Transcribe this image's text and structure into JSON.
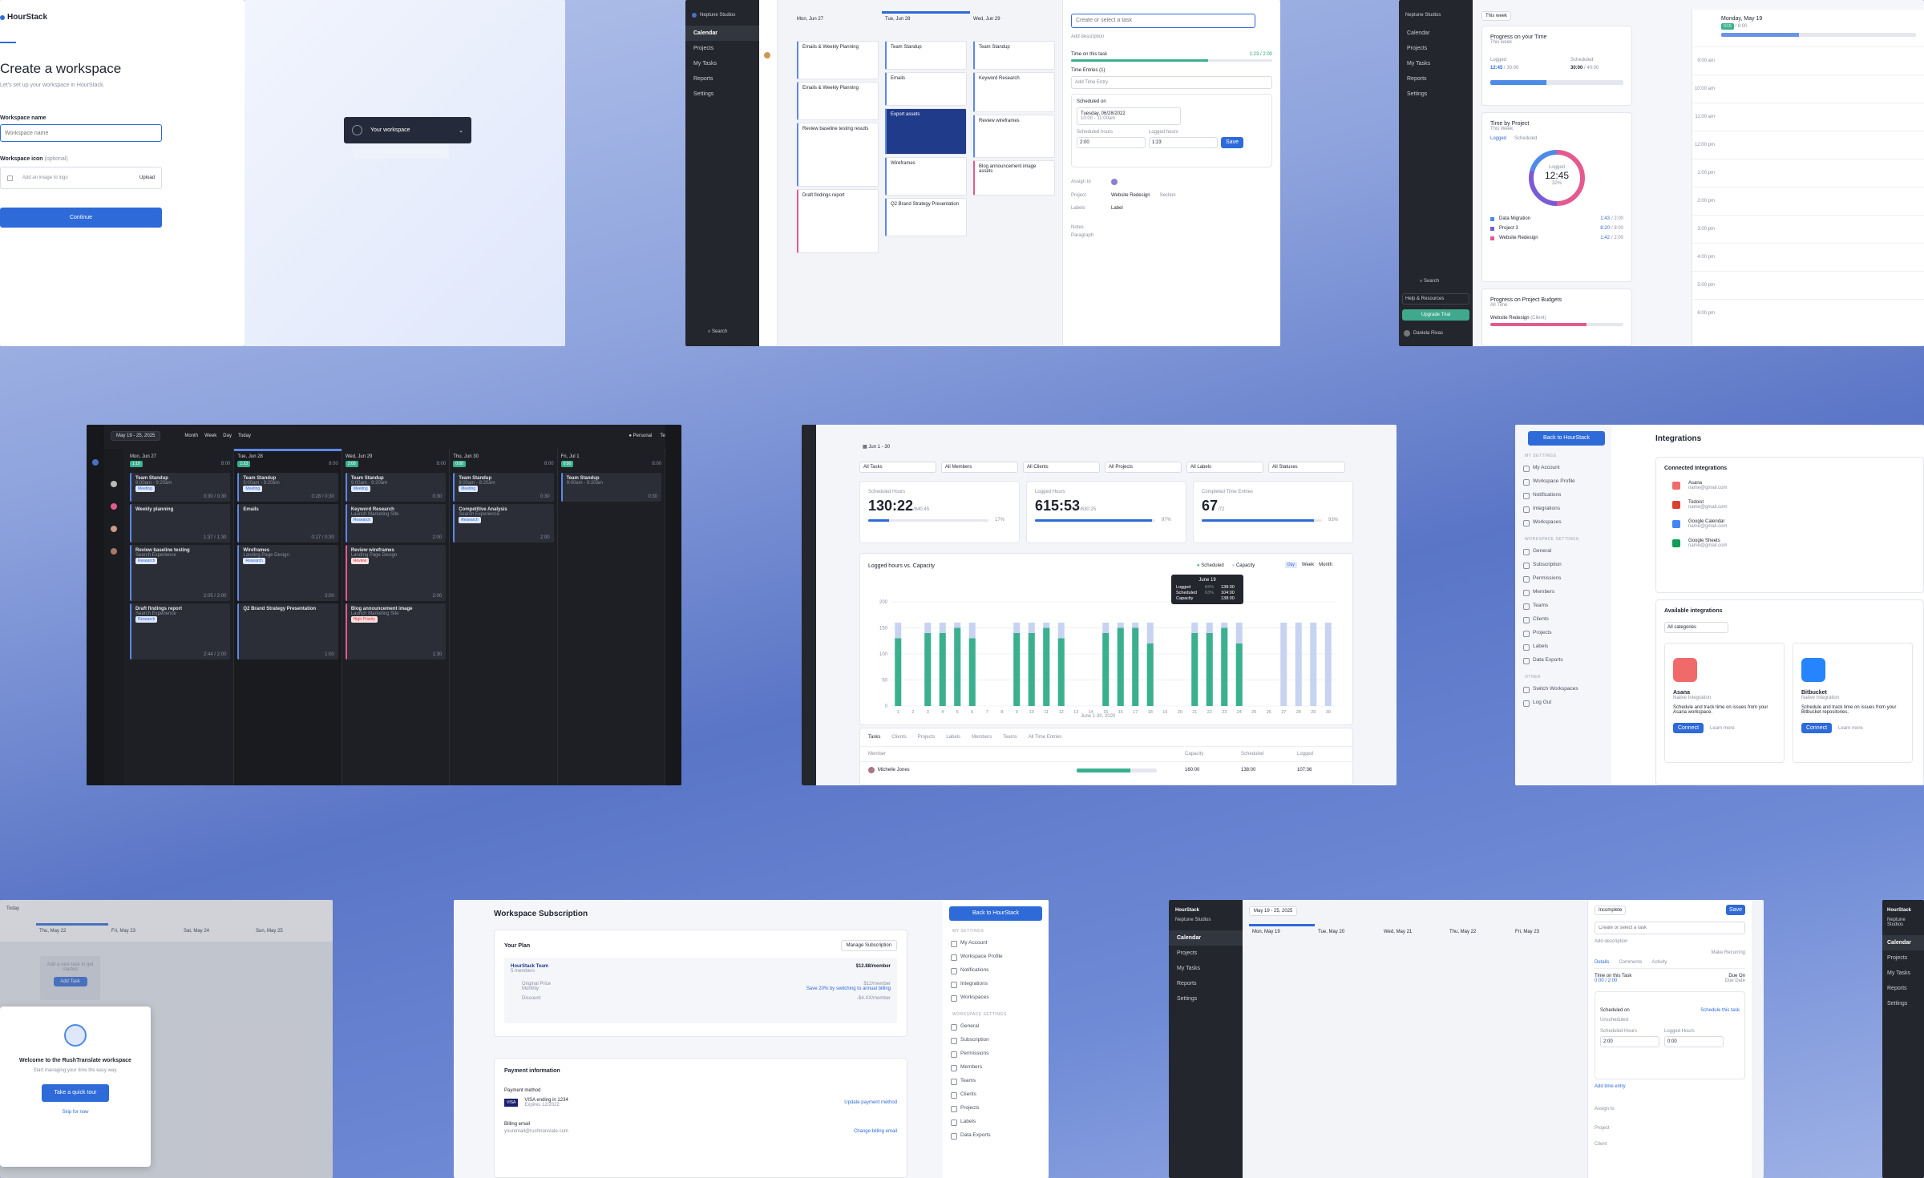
{
  "brand": {
    "name": "HourStack",
    "workspace": "Neptune Studios"
  },
  "onboarding": {
    "title": "Create a workspace",
    "subtitle": "Let's set up your workspace in HourStack.",
    "name_label": "Workspace name",
    "name_placeholder": "Workspace name",
    "icon_label": "Workspace icon",
    "icon_optional": "(optional)",
    "icon_placeholder": "Add an image to logo",
    "upload": "Upload",
    "continue": "Continue",
    "preview_name": "Your workspace"
  },
  "nav": {
    "calendar": "Calendar",
    "projects": "Projects",
    "my_tasks": "My Tasks",
    "reports": "Reports",
    "settings": "Settings",
    "search": "Search",
    "help": "Help & Resources",
    "upgrade": "Upgrade Trial",
    "user": "Daniela Rivas"
  },
  "calendar_light": {
    "days": [
      "Mon, Jun 27",
      "Tue, Jun 28",
      "Wed, Jun 29"
    ],
    "mon_cards": [
      "Emails & Weekly Planning",
      "Emails & Weekly Planning",
      "Review baseline testing results",
      "Draft findings report"
    ],
    "tue_cards": [
      "Team Standup",
      "Emails",
      "Export assets",
      "Wireframes",
      "Q2 Brand Strategy Presentation"
    ],
    "wed_cards": [
      "Team Standup",
      "Keyword Research",
      "Review wireframes",
      "Blog announcement image assets"
    ]
  },
  "task_detail": {
    "placeholder": "Create or select a task",
    "description": "Add description",
    "time_label": "Time on this task",
    "time_value": "1:23 / 2:00",
    "entries": "Time Entries (1)",
    "add_entry": "Add Time Entry",
    "scheduled_on": "Scheduled on",
    "date": "Tuesday, 06/28/2022",
    "time": "10:00 - 11:00am",
    "sched_hours": "Scheduled hours",
    "logged_hours": "Logged hours",
    "sched_val": "2:00",
    "logged_val": "1:23",
    "save": "Save",
    "assign": "Assign to",
    "project": "Project",
    "project_val": "Website Redesign",
    "section": "Section",
    "labels": "Labels",
    "label_val": "Label",
    "notes": "Notes",
    "paragraph": "Paragraph"
  },
  "dashboard": {
    "range": "This week",
    "progress_title": "Progress on your Time",
    "progress_sub": "This week",
    "logged": "Logged",
    "scheduled": "Scheduled",
    "logged_val": "12:45",
    "logged_of": "/ 30:00",
    "sched_val": "30:00",
    "sched_of": "/ 40:00",
    "by_project": "Time by Project",
    "by_project_sub": "This Week",
    "tab_logged": "Logged",
    "tab_sched": "Scheduled",
    "ring_label": "Logged",
    "ring_val": "12:45",
    "ring_pct": "32%",
    "projects": [
      {
        "name": "Data Migration",
        "val": "1:43",
        "of": "/ 2:00",
        "color": "#4c8be6"
      },
      {
        "name": "Project 3",
        "val": "8:20",
        "of": "/ 8:00",
        "color": "#7a5bd6"
      },
      {
        "name": "Website Redesign",
        "val": "1:42",
        "of": "/ 2:00",
        "color": "#e45a8f"
      }
    ],
    "budgets": "Progress on Project Budgets",
    "budgets_sub": "All Time",
    "budget_item": "Website Redesign",
    "budget_client": "(Client)",
    "day": "Monday, May 19",
    "day_badge": "0:15",
    "day_total": "/ 8:00",
    "hours": [
      "9:00 am",
      "10:00 am",
      "11:00 am",
      "12:00 pm",
      "1:00 pm",
      "2:00 pm",
      "3:00 pm",
      "4:00 pm",
      "5:00 pm",
      "6:00 pm"
    ]
  },
  "dark_cal": {
    "range": "May 19 - 25, 2025",
    "views": [
      "Month",
      "Week",
      "Day",
      "Today"
    ],
    "personal": "Personal",
    "team": "Team",
    "days": [
      {
        "name": "Mon, Jun 27",
        "a": "1:10",
        "b": "8:00"
      },
      {
        "name": "Tue, Jun 28",
        "a": "1:23",
        "b": "8:00"
      },
      {
        "name": "Wed, Jun 29",
        "a": "2:00",
        "b": "8:00"
      },
      {
        "name": "Thu, Jun 30",
        "a": "0:00",
        "b": "8:00"
      },
      {
        "name": "Fri, Jul 1",
        "a": "0:00",
        "b": "8:00"
      }
    ],
    "cols": [
      [
        {
          "t": "Team Standup",
          "s": "9:00am - 9:20am",
          "tag": "Meeting",
          "m": "0:30 / 0:30"
        },
        {
          "t": "Weekly planning",
          "s": "",
          "tag": "",
          "m": "1:37 / 1:30"
        },
        {
          "t": "Review baseline testing",
          "s": "Search Experience",
          "tag": "Research",
          "m": "2:05 / 2:00"
        },
        {
          "t": "Draft findings report",
          "s": "Search Experience",
          "tag": "Research",
          "m": "2:44 / 2:00"
        }
      ],
      [
        {
          "t": "Team Standup",
          "s": "9:00am - 9:20am",
          "tag": "Meeting",
          "m": "0:28 / 0:30"
        },
        {
          "t": "Emails",
          "s": "",
          "tag": "",
          "m": "0:17 / 0:30"
        },
        {
          "t": "Wireframes",
          "s": "Landing Page Design",
          "tag": "Research",
          "m": "3:00"
        },
        {
          "t": "Q2 Brand Strategy Presentation",
          "s": "",
          "tag": "",
          "m": "1:00"
        }
      ],
      [
        {
          "t": "Team Standup",
          "s": "9:00am - 9:20am",
          "tag": "Meeting",
          "m": "0:30"
        },
        {
          "t": "Keyword Research",
          "s": "Launch Marketing Site",
          "tag": "Research",
          "m": "2:00"
        },
        {
          "t": "Review wireframes",
          "s": "Landing Page Design",
          "tag": "Review",
          "m": "2:00"
        },
        {
          "t": "Blog announcement image",
          "s": "Launch Marketing Site",
          "tag": "High Priority",
          "m": "1:30"
        }
      ],
      [
        {
          "t": "Team Standup",
          "s": "9:00am - 9:20am",
          "tag": "Meeting",
          "m": "0:30"
        },
        {
          "t": "Competitive Analysis",
          "s": "Search Experience",
          "tag": "Research",
          "m": "2:00"
        }
      ],
      [
        {
          "t": "Team Standup",
          "s": "9:00am - 9:20am",
          "tag": "",
          "m": "0:30"
        }
      ]
    ]
  },
  "report": {
    "range": "Jun 1 - 30",
    "filters": [
      "All Tasks",
      "All Members",
      "All Clients",
      "All Projects",
      "All Labels",
      "All Statuses"
    ],
    "stats": [
      {
        "label": "Scheduled Hours",
        "val": "130:22",
        "of": "/840:45",
        "pct": "17%",
        "fill": 0.17
      },
      {
        "label": "Logged Hours",
        "val": "615:53",
        "of": "/630:25",
        "pct": "97%",
        "fill": 0.97
      },
      {
        "label": "Completed Time Entries",
        "val": "67",
        "of": "/72",
        "pct": "93%",
        "fill": 0.93
      }
    ],
    "chart_title": "Logged hours vs. Capacity",
    "legend_sched": "Scheduled",
    "legend_cap": "Capacity",
    "period": [
      "Day",
      "Week",
      "Month"
    ],
    "xlabel": "June 1-30, 2020",
    "tooltip": {
      "date": "June 19",
      "rows": [
        [
          "Logged",
          "84%",
          "138:00"
        ],
        [
          "Scheduled",
          "63%",
          "104:00"
        ],
        [
          "Capacity",
          "",
          "138:00"
        ]
      ]
    },
    "tabs": [
      "Tasks",
      "Clients",
      "Projects",
      "Labels",
      "Members",
      "Teams",
      "All Time Entries"
    ],
    "table_head": [
      "Member",
      "Capacity",
      "Scheduled",
      "Logged"
    ],
    "table_row": [
      "Michelle Jones",
      "160:00",
      "138:00",
      "107:36"
    ]
  },
  "chart_data": {
    "type": "bar",
    "title": "Logged hours vs. Capacity",
    "xlabel": "June 1-30, 2020",
    "ylabel": "",
    "ylim": [
      0,
      200
    ],
    "categories": [
      "1",
      "2",
      "3",
      "4",
      "5",
      "6",
      "7",
      "8",
      "9",
      "10",
      "11",
      "12",
      "13",
      "14",
      "15",
      "16",
      "17",
      "18",
      "19",
      "20",
      "21",
      "22",
      "23",
      "24",
      "25",
      "26",
      "27",
      "28",
      "29",
      "30"
    ],
    "series": [
      {
        "name": "Scheduled",
        "values": [
          130,
          0,
          140,
          140,
          150,
          130,
          0,
          0,
          140,
          140,
          150,
          130,
          0,
          0,
          140,
          150,
          150,
          120,
          0,
          0,
          140,
          140,
          150,
          120,
          0,
          0,
          0,
          0,
          0,
          0
        ]
      },
      {
        "name": "Capacity",
        "values": [
          160,
          0,
          160,
          160,
          160,
          160,
          0,
          0,
          160,
          160,
          160,
          160,
          0,
          0,
          160,
          160,
          160,
          160,
          0,
          0,
          160,
          160,
          160,
          160,
          0,
          0,
          160,
          160,
          160,
          160
        ]
      }
    ]
  },
  "integrations": {
    "back": "Back to HourStack",
    "title": "Integrations",
    "connected": "Connected Integrations",
    "items": [
      {
        "name": "Asana",
        "email": "name@gmail.com",
        "color": "#f06a6a"
      },
      {
        "name": "Todoist",
        "email": "name@gmail.com",
        "color": "#db4035"
      },
      {
        "name": "Google Calendar",
        "email": "name@gmail.com",
        "color": "#4285f4"
      },
      {
        "name": "Google Sheets",
        "email": "name@gmail.com",
        "color": "#0f9d58"
      }
    ],
    "available": "Available integrations",
    "categories": "All categories",
    "cards": [
      {
        "name": "Asana",
        "kind": "Native Integration",
        "desc": "Schedule and track time on issues from your Asana workspace.",
        "color": "#f06a6a"
      },
      {
        "name": "Bitbucket",
        "kind": "Native Integration",
        "desc": "Schedule and track time on issues from your Bitbucket repositories.",
        "color": "#2684ff"
      }
    ],
    "connect": "Connect",
    "learn": "Learn more"
  },
  "settings_nav": {
    "my_settings": "MY SETTINGS",
    "my": [
      "My Account",
      "Workspace Profile",
      "Notifications",
      "Integrations",
      "Workspaces"
    ],
    "ws_settings": "WORKSPACE SETTINGS",
    "ws": [
      "General",
      "Subscription",
      "Permissions",
      "Members",
      "Teams",
      "Clients",
      "Projects",
      "Labels",
      "Data Exports"
    ],
    "other": "OTHER",
    "other_items": [
      "Switch Workspaces",
      "Log Out"
    ]
  },
  "welcome": {
    "today": "Today",
    "days": [
      "Thu, May 22",
      "Fri, May 23",
      "Sat, May 24",
      "Sun, May 25"
    ],
    "empty": "Add a new task to get started",
    "add_task": "Add Task",
    "title": "Welcome to the RushTranslate workspace",
    "sub": "Start managing your time the easy way.",
    "tour": "Take a quick tour",
    "skip": "Skip for now"
  },
  "subscription": {
    "title": "Workspace Subscription",
    "plan_label": "Your Plan",
    "manage": "Manage Subscription",
    "plan": "HourStack Team",
    "members": "5 members",
    "price": "$12.88/member",
    "orig_label": "Original Price",
    "orig_sub": "Monthly",
    "orig_val": "$12/member",
    "save": "Save 20% by switching to annual billing",
    "discount": "Discount",
    "discount_val": "-$4.XX/member",
    "payment": "Payment information",
    "method_label": "Payment method",
    "card": "VISA ending in 1234",
    "expires": "Expires 12/2022",
    "update": "Update payment method",
    "email_label": "Billing email",
    "email": "youremail@rushtranslate.com",
    "change": "Change billing email"
  },
  "bottom_right": {
    "status": "Incomplete",
    "save": "Save",
    "task_placeholder": "Create or select a task",
    "description": "Add description",
    "recurring": "Make Recurring",
    "tabs": [
      "Details",
      "Comments",
      "Activity"
    ],
    "time_label": "Time on this Task",
    "time_val": "0:00 / 2:00",
    "due_label": "Due On",
    "due_val": "Due Date",
    "sched_on": "Scheduled on",
    "sched_link": "Schedule this task",
    "unscheduled": "Unscheduled",
    "sched_h": "Scheduled Hours",
    "logged_h": "Logged Hours",
    "sh": "2:00",
    "lh": "0:00",
    "add_entry": "Add time entry",
    "assign": "Assign to",
    "project": "Project",
    "client": "Client",
    "range": "May 19 - 25, 2025",
    "days": [
      "Mon, May 19",
      "Tue, May 20",
      "Wed, May 21",
      "Thu, May 22",
      "Fri, May 23"
    ]
  }
}
